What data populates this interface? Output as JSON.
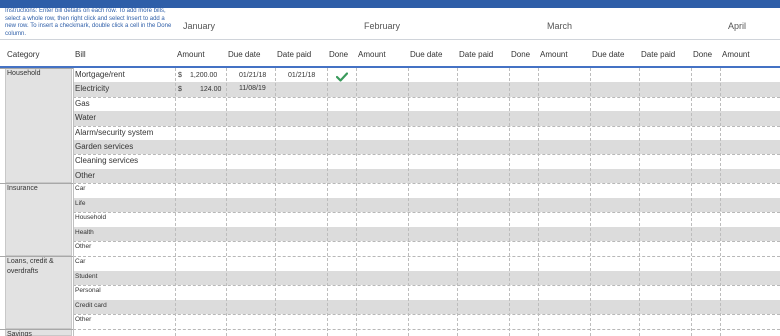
{
  "instructions": "Instructions: Enter bill details on each row. To add more bills, select a whole row, then right click and select Insert to add a new row. To insert a checkmark, double click a cell in the Done column.",
  "months": [
    "January",
    "February",
    "March",
    "April"
  ],
  "headers": {
    "category": "Category",
    "bill": "Bill",
    "groups": [
      [
        "Amount",
        "Due date",
        "Date paid",
        "Done"
      ],
      [
        "Amount",
        "Due date",
        "Date paid",
        "Done"
      ],
      [
        "Amount",
        "Due date",
        "Date paid",
        "Done"
      ],
      [
        "Amount"
      ]
    ]
  },
  "categories": [
    {
      "name": "Household",
      "bills": [
        "Mortgage/rent",
        "Electricity",
        "Gas",
        "Water",
        "Alarm/security system",
        "Garden services",
        "Cleaning services",
        "Other"
      ]
    },
    {
      "name": "Insurance",
      "bills": [
        "Car",
        "Life",
        "Household",
        "Health",
        "Other"
      ]
    },
    {
      "name": "Loans, credit & overdrafts",
      "bills": [
        "Car",
        "Student",
        "Personal",
        "Credit card",
        "Other"
      ]
    },
    {
      "name": "Savings",
      "bills": [
        ""
      ]
    }
  ],
  "entries": {
    "mortgage": {
      "currency": "$",
      "amount": "1,200.00",
      "due": "01/21/18",
      "paid": "01/21/18",
      "done": true
    },
    "electricity": {
      "currency": "$",
      "amount": "124.00",
      "due": "11/08/19"
    }
  },
  "colors": {
    "accent": "#2e5ea8",
    "check": "#3a9a5c",
    "band": "#dcdcdc"
  }
}
